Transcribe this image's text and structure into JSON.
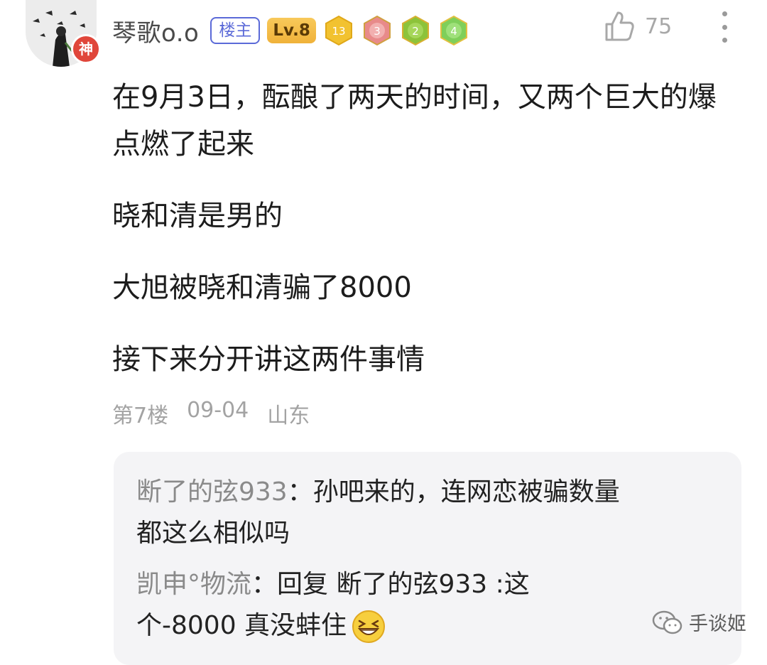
{
  "post": {
    "author": {
      "name": "琴歌o.o",
      "avatar_badge": "神",
      "op_label": "楼主",
      "level": "Lv.8",
      "medals": [
        {
          "icon": "hexagon-medal-yellow-icon",
          "label": "13",
          "color": "#f2c230"
        },
        {
          "icon": "hexagon-medal-pink-icon",
          "label": "3",
          "color": "#e88a8a"
        },
        {
          "icon": "hexagon-medal-green-icon",
          "label": "2",
          "color": "#8dc33a"
        },
        {
          "icon": "hexagon-medal-green-icon",
          "label": "4",
          "color": "#7fcf5a"
        }
      ]
    },
    "likes": "75",
    "paragraphs": [
      "在9月3日，酝酿了两天的时间，又两个巨大的爆点燃了起来",
      "晓和清是男的",
      "大旭被晓和清骗了8000",
      "接下来分开讲这两件事情"
    ],
    "floor": "第7楼",
    "date": "09-04",
    "location": "山东"
  },
  "replies": [
    {
      "name": "断了的弦933",
      "line1": "：孙吧来的，连网恋被骗数量",
      "line2": "都这么相似吗"
    },
    {
      "name": "凯申°物流",
      "line1": "：回复 断了的弦933 :这",
      "line2": "个-8000 真没蚌住",
      "emoji": "grinning-squint-emoji-icon"
    }
  ],
  "watermark": "手谈姬",
  "colors": {
    "op_badge": "#5b6ad8",
    "level_badge": "#f0b23a",
    "reply_bg": "#f4f4f6",
    "avatar_badge": "#e0463a"
  }
}
